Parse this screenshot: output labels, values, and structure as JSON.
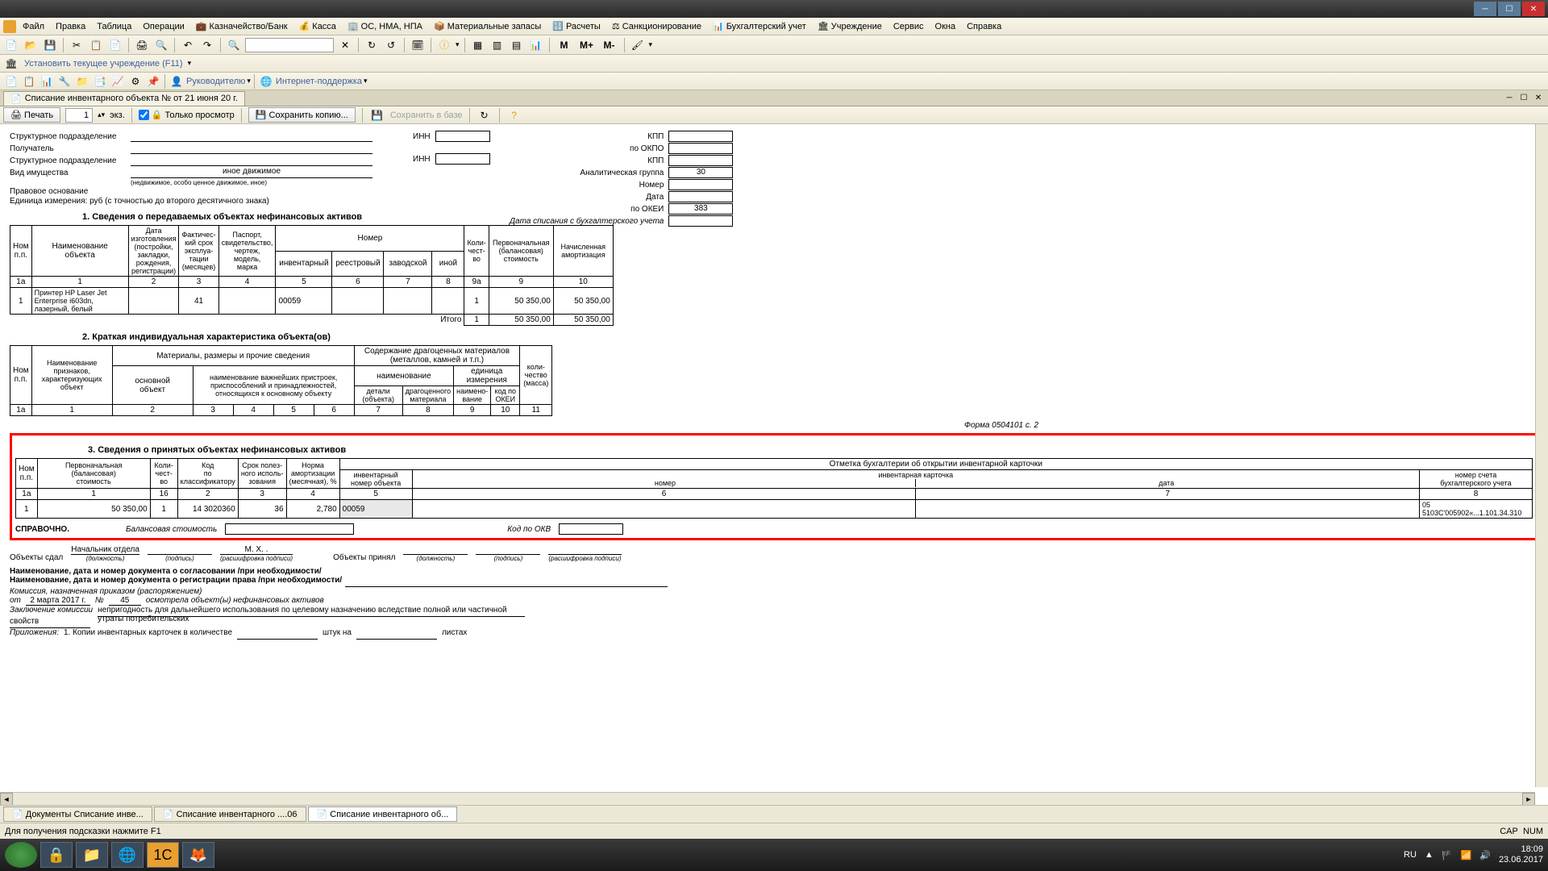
{
  "window": {
    "title": ""
  },
  "menu": {
    "file": "Файл",
    "edit": "Правка",
    "table": "Таблица",
    "operations": "Операции",
    "treasury": "Казначейство/Банк",
    "kassa": "Касса",
    "os": "ОС, НМА, НПА",
    "materials": "Материальные запасы",
    "calculations": "Расчеты",
    "sanctions": "Санкционирование",
    "accounting": "Бухгалтерский учет",
    "institution": "Учреждение",
    "service": "Сервис",
    "windows": "Окна",
    "help": "Справка"
  },
  "toolbar2": {
    "m": "M",
    "mplus": "M+",
    "mminus": "M-"
  },
  "subbar": {
    "set_institution": "Установить текущее учреждение (F11)"
  },
  "subbar2": {
    "ruk": "Руководителю",
    "internet": "Интернет-поддержка"
  },
  "doc_tab": {
    "title": "Списание инвентарного объекта №             от 21 июня 20      г."
  },
  "printbar": {
    "print": "Печать",
    "copies": "1",
    "ekz": "экз.",
    "view_only": "Только просмотр",
    "save_copy": "Сохранить копию...",
    "save_db": "Сохранить в базе"
  },
  "header": {
    "struct_dept": "Структурное подразделение",
    "recipient": "Получатель",
    "struct_dept2": "Структурное подразделение",
    "property_type_label": "Вид имущества",
    "property_type_value": "иное движимое",
    "property_note": "(недвижимое, особо ценное движимое, иное)",
    "legal_basis": "Правовое основание",
    "unit_measure": "Единица измерения: руб (с точностью до второго десятичного знака)",
    "inn": "ИНН",
    "kpp": "КПП",
    "okpo": "по ОКПО",
    "kpp2": "КПП",
    "analytic_group": "Аналитическая группа",
    "ag_val": "30",
    "number": "Номер",
    "date": "Дата",
    "okei": "по ОКЕИ",
    "okei_val": "383",
    "writeoff_date": "Дата списания с бухгалтерского учета"
  },
  "section1": {
    "title": "1. Сведения о передаваемых объектах нефинансовых активов",
    "h_nom": "Ном\nп.п.",
    "h_name": "Наименование\nобъекта",
    "h_date": "Дата\nизготовления\n(постройки,\nзакладки,\nрождения,\nрегистрации)",
    "h_actual": "Фактичес-\nкий срок\nэксплуа-\nтации\n(месяцев)",
    "h_passport": "Паспорт,\nсвидетельство,\nчертеж,\nмодель,\nмарка",
    "h_number": "Номер",
    "h_inv": "инвентарный",
    "h_reg": "реестровый",
    "h_factory": "заводской",
    "h_other": "иной",
    "h_qty": "Коли-\nчест-\nво",
    "h_initial": "Первоначальная\n(балансовая)\nстоимость",
    "h_amort": "Начисленная\nамортизация",
    "row_nums": [
      "1а",
      "1",
      "2",
      "3",
      "4",
      "5",
      "6",
      "7",
      "8",
      "9а",
      "9",
      "10"
    ],
    "data_row": {
      "num": "1",
      "name": "Принтер HP Laser Jet Enterprise     i603dn, лазерный, белый",
      "actual": "41",
      "inv": "00059",
      "qty": "1",
      "initial": "50 350,00",
      "amort": "50 350,00"
    },
    "total": "Итого",
    "total_qty": "1",
    "total_initial": "50 350,00",
    "total_amort": "50 350,00"
  },
  "section2": {
    "title": "2. Краткая индивидуальная характеристика объекта(ов)",
    "h_nom": "Ном\nп.п.",
    "h_features": "Наименование\nпризнаков,\nхарактеризующих\nобъект",
    "h_materials": "Материалы, размеры и прочие сведения",
    "h_main": "основной\nобъект",
    "h_attach": "наименование важнейших пристроек,\nприспособлений и принадлежностей,\nотносящихся к основному объекту",
    "h_precious": "Содержание драгоценных материалов (металлов, камней и т.п.)",
    "h_prec_name": "наименование",
    "h_prec_unit": "единица измерения",
    "h_detail": "детали\n(объекта)",
    "h_precmat": "драгоценного\nматериала",
    "h_unitname": "наимено-\nвание",
    "h_okei": "код по\nОКЕИ",
    "h_mass": "коли-\nчество\n(масса)",
    "row_nums": [
      "1а",
      "1",
      "2",
      "3",
      "4",
      "5",
      "6",
      "7",
      "8",
      "9",
      "10",
      "11"
    ]
  },
  "form_page": "Форма 0504101 с. 2",
  "section3": {
    "title": "3. Сведения о принятых объектах нефинансовых активов",
    "h_nom": "Ном\nп.п.",
    "h_initial": "Первоначальная\n(балансовая)\nстоимость",
    "h_qty": "Коли-\nчест-\nво",
    "h_code": "Код\nпо\nклассификатору",
    "h_useful": "Срок полез-\nного исполь-\nзования",
    "h_norm": "Норма\nамортизации\n(месячная), %",
    "h_mark": "Отметка бухгалтерии об открытии инвентарной карточки",
    "h_invnum": "инвентарный\nномер объекта",
    "h_card": "инвентарная карточка",
    "h_cardnum": "номер",
    "h_carddate": "дата",
    "h_account": "номер счета\nбухгалтерского учета",
    "row_nums": [
      "1а",
      "1",
      "16",
      "2",
      "3",
      "4",
      "5",
      "6",
      "7",
      "8"
    ],
    "data_row": {
      "num": "1",
      "initial": "50 350,00",
      "qty": "1",
      "code": "14 3020360",
      "useful": "36",
      "norm": "2,780",
      "invnum": "00059",
      "account": "05  5103С'005902«...1.101.34.310"
    },
    "spravochno": "СПРАВОЧНО.",
    "balance": "Балансовая стоимость",
    "okv": "Код по ОКВ"
  },
  "signatures": {
    "obj_sent": "Объекты сдал",
    "position1": "Начальник отдела",
    "name1": "М. Х.    .",
    "obj_recv": "Объекты принял",
    "sub_pos": "(подпись)",
    "sub_name": "(расшифровка подписи)",
    "sub_dol": "(должность)"
  },
  "bottom_text": {
    "agreement": "Наименование, дата и номер документа о согласовании /при необходимости/",
    "registration": "Наименование, дата и номер документа о регистрации права /при необходимости/",
    "commission": "Комиссия, назначенная приказом (распоряжением)",
    "from": "от",
    "from_date": "2 марта 2017 г.",
    "num": "№",
    "num_val": "45",
    "inspected": "осмотрела объект(ы) нефинансовых активов",
    "conclusion": "Заключение комиссии",
    "conclusion_text": "непригодность для дальнейшего использования по целевому назначению вследствие полной или частичной утраты потребительских",
    "properties": "свойств",
    "attachments": "Приложения:",
    "att_text": "1. Копии инвентарных карточек в количестве",
    "pieces": "штук на",
    "sheets": "листах"
  },
  "bottom_tabs": {
    "t1": "Документы Списание инве...",
    "t2": "Списание инвентарного ....06",
    "t3": "Списание инвентарного об..."
  },
  "status": {
    "hint": "Для получения подсказки нажмите F1",
    "cap": "CAP",
    "num": "NUM"
  },
  "tray": {
    "lang": "RU",
    "time": "18:09",
    "date": "23.06.2017"
  }
}
